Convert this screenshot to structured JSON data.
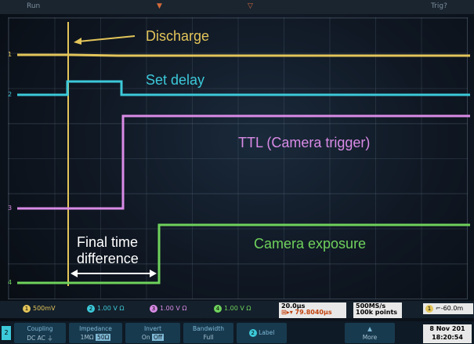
{
  "topbar": {
    "left": "Run",
    "right": "Trig?"
  },
  "annotations": {
    "discharge": "Discharge",
    "set_delay": "Set delay",
    "ttl": "TTL  (Camera trigger)",
    "camera_exposure": "Camera exposure",
    "final_time_line1": "Final time",
    "final_time_line2": "difference"
  },
  "colors": {
    "ch1": "#e3c55a",
    "ch2": "#3cc9d9",
    "ch3": "#d98be6",
    "ch4": "#6fd25c"
  },
  "status": {
    "ch1_scale": "500mV",
    "ch2_scale": "1.00 V Ω",
    "ch3_scale": "1.00 V Ω",
    "ch4_scale": "1.00 V Ω",
    "timebase": "20.0µs",
    "trigger_pos": "79.8040µs",
    "sample_rate": "500MS/s",
    "points": "100k points",
    "trigger_level": "-60.0m"
  },
  "menu": {
    "coupling": {
      "title": "Coupling",
      "opts": "DC  AC  ⏚"
    },
    "impedance": {
      "title": "Impedance",
      "opt1": "1MΩ",
      "opt2": "50Ω"
    },
    "invert": {
      "title": "Invert",
      "opt1": "On",
      "opt2": "Off"
    },
    "bandwidth": {
      "title": "Bandwidth",
      "opt1": "Full"
    },
    "label": {
      "num": "2",
      "title": "Label"
    },
    "more": "More",
    "date": "8 Nov 201",
    "time": "18:20:54"
  }
}
